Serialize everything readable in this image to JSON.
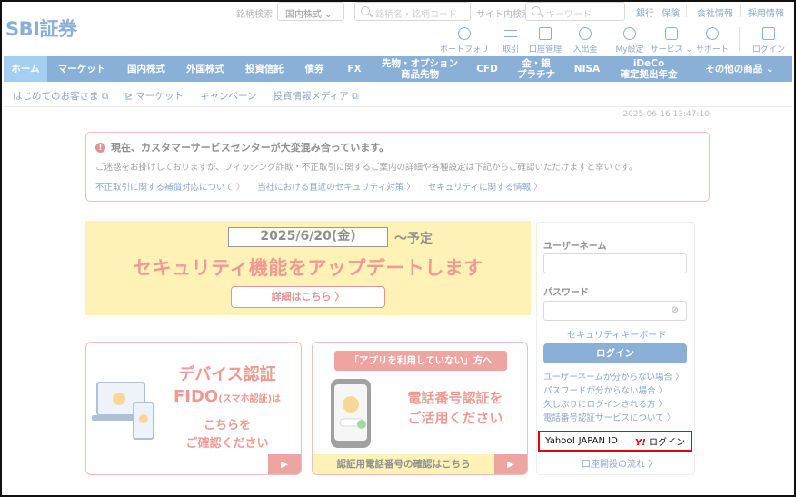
{
  "header": {
    "logo_text": "SBI証券",
    "brand_search_label": "銘柄検索",
    "market_select": "国内株式",
    "stock_search_placeholder": "銘柄名・銘柄コード",
    "site_search_label": "サイト内検索",
    "keyword_placeholder": "キーワード",
    "top_links": [
      "銀行",
      "保険",
      "会社情報",
      "採用情報"
    ],
    "tools": [
      "ポートフォリオ",
      "取引",
      "口座管理",
      "入出金",
      "My設定",
      "サービス",
      "サポート",
      "ログイン"
    ]
  },
  "nav": {
    "items": [
      "ホーム",
      "マーケット",
      "国内株式",
      "外国株式",
      "投資信託",
      "債券",
      "FX",
      "先物・オプション\n商品先物",
      "CFD",
      "金・銀\nプラチナ",
      "NISA",
      "iDeCo\n確定拠出年金",
      "その他の商品 ⌄"
    ]
  },
  "subnav": {
    "items": [
      "はじめてのお客さま",
      "マーケット",
      "キャンペーン",
      "投資情報メディア"
    ]
  },
  "timestamp": "2025-06-16 13:47:10",
  "alert": {
    "title": "現在、カスタマーサービスセンターが大変混み合っています。",
    "body": "ご迷惑をお掛けしておりますが、フィッシング詐欺・不正取引に関するご案内の詳細や各種設定は下記からご確認いただけますと幸いです。",
    "links": [
      "不正取引に関する補償対応について",
      "当社における直近のセキュリティ対策",
      "セキュリティに関する情報"
    ]
  },
  "banner": {
    "date": "2025/6/20(金)",
    "date_suffix": "～予定",
    "headline": "セキュリティ機能をアップデートします",
    "button": "詳細はこちら 〉"
  },
  "card1": {
    "line1": "デバイス認証",
    "line2a": "FIDO",
    "line2b": "(スマホ認証)",
    "line2c": "は",
    "line3": "こちらを",
    "line4": "ご確認ください",
    "arrow": "▶"
  },
  "card2": {
    "pill": "「アプリを利用していない」方へ",
    "line1": "電話番号認証を",
    "line2": "ご活用ください",
    "bottom": "認証用電話番号の確認はこちら",
    "arrow": "▶"
  },
  "login": {
    "username_label": "ユーザーネーム",
    "password_label": "パスワード",
    "security_keyboard": "セキュリティキーボード",
    "login_button": "ログイン",
    "help_links": [
      "ユーザーネームが分からない場合 〉",
      "パスワードが分からない場合 〉",
      "久しぶりにログインされる方 〉",
      "電話番号認証サービスについて 〉"
    ],
    "yahoo_label": "Yahoo! JAPAN ID",
    "yahoo_logo": "Y!",
    "yahoo_login": "ログイン",
    "open_account": "口座開設の流れ 〉"
  },
  "colors": {
    "brand": "#2c6fb7",
    "alert": "#e08a8a",
    "banner": "#fde87c",
    "highlight": "#e60012"
  }
}
